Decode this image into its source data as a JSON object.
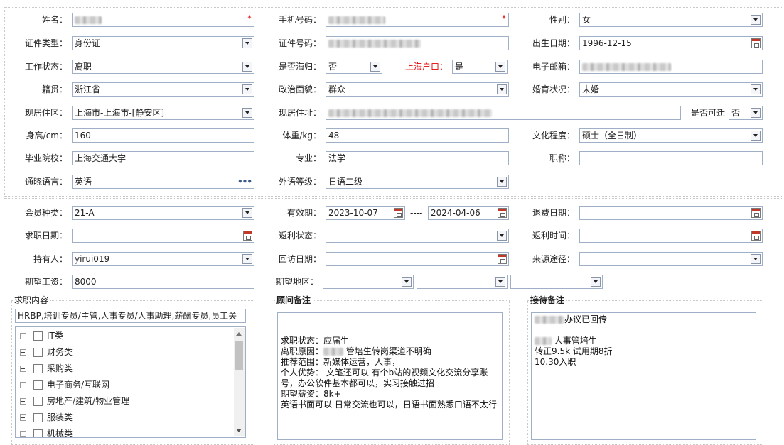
{
  "basic": {
    "name": {
      "label": "姓名："
    },
    "phone": {
      "label": "手机号码："
    },
    "gender": {
      "label": "性别：",
      "value": "女"
    },
    "id_type": {
      "label": "证件类型：",
      "value": "身份证"
    },
    "id_number": {
      "label": "证件号码："
    },
    "birth_date": {
      "label": "出生日期：",
      "value": "1996-12-15"
    },
    "work_status": {
      "label": "工作状态：",
      "value": "离职"
    },
    "returnee": {
      "label": "是否海归：",
      "value": "否"
    },
    "shanghai_hukou": {
      "label": "上海户口：",
      "value": "是"
    },
    "email": {
      "label": "电子邮箱："
    },
    "native_place": {
      "label": "籍贯：",
      "value": "浙江省"
    },
    "political": {
      "label": "政治面貌：",
      "value": "群众"
    },
    "marital": {
      "label": "婚育状况：",
      "value": "未婚"
    },
    "current_area": {
      "label": "现居住区：",
      "value": "上海市-上海市-[静安区]"
    },
    "current_address": {
      "label": "现居住址："
    },
    "relocate": {
      "label": "是否可迁",
      "value": "否"
    },
    "height": {
      "label": "身高/cm：",
      "value": "160"
    },
    "weight": {
      "label": "体重/kg：",
      "value": "48"
    },
    "education": {
      "label": "文化程度：",
      "value": "硕士（全日制）"
    },
    "school": {
      "label": "毕业院校：",
      "value": "上海交通大学"
    },
    "major": {
      "label": "专业：",
      "value": "法学"
    },
    "title": {
      "label": "职称：",
      "value": ""
    },
    "language": {
      "label": "通晓语言：",
      "value": "英语"
    },
    "language_level": {
      "label": "外语等级：",
      "value": "日语二级"
    }
  },
  "member": {
    "member_type": {
      "label": "会员种类：",
      "value": "21-A"
    },
    "validity": {
      "label": "有效期：",
      "start": "2023-10-07",
      "separator": "----",
      "end": "2024-04-06"
    },
    "refund_date": {
      "label": "退费日期：",
      "value": ""
    },
    "job_seek_date": {
      "label": "求职日期：",
      "value": ""
    },
    "rebate_status": {
      "label": "返利状态：",
      "value": ""
    },
    "rebate_time": {
      "label": "返利时间：",
      "value": ""
    },
    "holder": {
      "label": "持有人：",
      "value": "yirui019"
    },
    "visit_date": {
      "label": "回访日期：",
      "value": ""
    },
    "source": {
      "label": "来源途径：",
      "value": ""
    },
    "expected_salary": {
      "label": "期望工资：",
      "value": "8000"
    },
    "expected_region": {
      "label": "期望地区：",
      "values": [
        "",
        "",
        ""
      ]
    }
  },
  "job_content": {
    "title": "求职内容",
    "selected": "HRBP,培训专员/主管,人事专员/人事助理,薪酬专员,员工关",
    "categories": [
      "IT类",
      "财务类",
      "采购类",
      "电子商务/互联网",
      "房地产/建筑/物业管理",
      "服装类",
      "机械类"
    ]
  },
  "consultant_remark": {
    "title": "顾问备注",
    "lines_before": "\n\n求职状态：应届生\n离职原因：",
    "lines_mid": " 管培生转岗渠道不明确\n推荐范围：新媒体运营，人事，\n个人优势： 文笔还可以 有个b站的视频文化交流分享账号，办公软件基本都可以，实习接触过招\n期望薪资：8k+\n英语书面可以 日常交流也可以，日语书面熟悉口语不太行"
  },
  "reception_remark": {
    "title": "接待备注",
    "line1": "办议已回传",
    "line2": " 人事管培生\n转正9.5k 试用期8折\n10.30入职"
  },
  "colors": {
    "required": "#e60000",
    "border": "#9fb0c6",
    "hukou_label": "#e60000"
  }
}
